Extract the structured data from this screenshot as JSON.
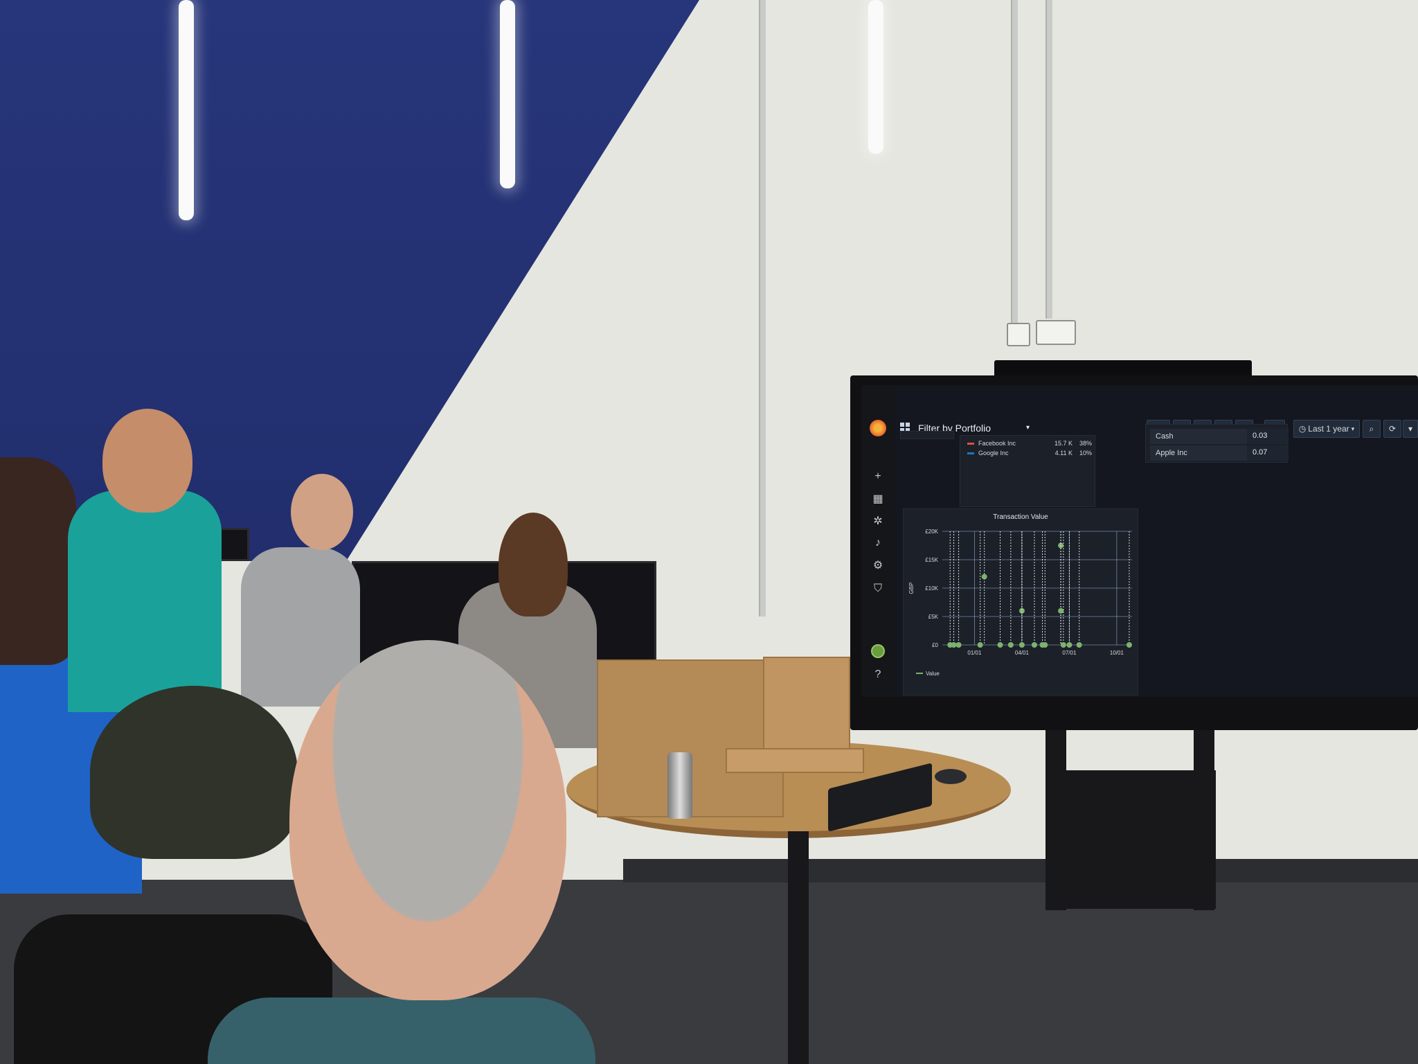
{
  "dashboard": {
    "title": "Filter by Portfolio",
    "time_range": "Last 1 year",
    "side_icons": [
      "grafana-logo-icon",
      "plus-icon",
      "dashboards-icon",
      "explore-icon",
      "alert-bell-icon",
      "gear-icon",
      "shield-icon"
    ],
    "legend_panel": {
      "rows": [
        {
          "name": "Facebook Inc",
          "value": "15.7 K",
          "percent": "38%",
          "color": "#e24d42"
        },
        {
          "name": "Google Inc",
          "value": "4.11 K",
          "percent": "10%",
          "color": "#1f78c1"
        }
      ]
    },
    "table_panel": {
      "rows": [
        {
          "name": "Cash",
          "value": "0.03"
        },
        {
          "name": "Apple Inc",
          "value": "0.07"
        }
      ]
    },
    "chart": {
      "title": "Transaction Value",
      "ylabel": "GBP",
      "yticks": [
        "£20K",
        "£15K",
        "£10K",
        "£5K",
        "£0"
      ],
      "xticks": [
        "01/01",
        "04/01",
        "07/01",
        "10/01"
      ],
      "legend": "Value"
    }
  },
  "chart_data": {
    "type": "scatter",
    "title": "Transaction Value",
    "xlabel": "",
    "ylabel": "GBP",
    "ylim": [
      0,
      20000
    ],
    "xticks": [
      "01/01",
      "04/01",
      "07/01",
      "10/01"
    ],
    "series": [
      {
        "name": "Value",
        "points": [
          {
            "x": "11/15",
            "y": 0
          },
          {
            "x": "11/22",
            "y": 0
          },
          {
            "x": "12/01",
            "y": 0
          },
          {
            "x": "01/12",
            "y": 0
          },
          {
            "x": "01/20",
            "y": 12000
          },
          {
            "x": "02/20",
            "y": 0
          },
          {
            "x": "03/10",
            "y": 0
          },
          {
            "x": "04/01",
            "y": 6000
          },
          {
            "x": "04/01",
            "y": 0
          },
          {
            "x": "04/25",
            "y": 0
          },
          {
            "x": "05/10",
            "y": 0
          },
          {
            "x": "05/15",
            "y": 0
          },
          {
            "x": "06/15",
            "y": 17500
          },
          {
            "x": "06/15",
            "y": 6000
          },
          {
            "x": "06/20",
            "y": 0
          },
          {
            "x": "07/01",
            "y": 0
          },
          {
            "x": "07/20",
            "y": 0
          },
          {
            "x": "10/25",
            "y": 0
          }
        ],
        "color": "#7eb26d"
      }
    ],
    "grid": true,
    "legend_placement": "bottom-left"
  }
}
